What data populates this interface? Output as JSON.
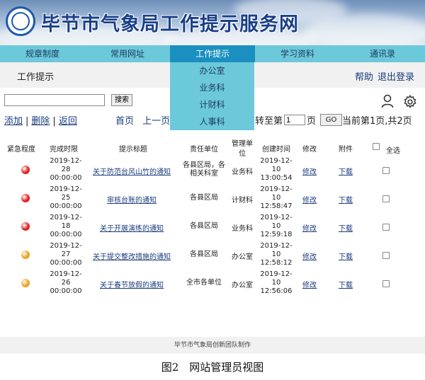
{
  "site_title": "毕节市气象局工作提示服务网",
  "nav": [
    "规章制度",
    "常用网址",
    "工作提示",
    "学习资料",
    "通讯录"
  ],
  "dropdown": [
    "办公室",
    "业务科",
    "计财科",
    "人事科"
  ],
  "page_title": "工作提示",
  "help": "帮助",
  "logout": "退出登录",
  "search": {
    "value": "",
    "button": "搜索"
  },
  "actions": {
    "add": "添加",
    "delete": "删除",
    "back": "返回",
    "sep": "|"
  },
  "pager": {
    "first": "首页",
    "prev": "上一页",
    "jump_prefix": "转至第",
    "page_value": "1",
    "page_suffix": "页",
    "go": "GO",
    "info": "当前第1页,共2页"
  },
  "table": {
    "headers": {
      "urgency": "紧急程度",
      "deadline": "完成时限",
      "title": "提示标题",
      "unit_line1": "责任单位",
      "mgmt_line1": "管理单",
      "mgmt_line2": "位",
      "created": "创建时间",
      "edit": "修改",
      "attach": "附件",
      "select_all": "全选"
    },
    "rows": [
      {
        "urgency": "#e02020",
        "deadline": [
          "2019-12-",
          "28",
          "00:00:00"
        ],
        "title": "关于防范台风山竹的通知",
        "unit": [
          "各县区局，各",
          "相关科室"
        ],
        "mgmt": "业务科",
        "created": [
          "2019-12-",
          "10",
          "13:00:54"
        ],
        "edit": "修改",
        "attach": "下载"
      },
      {
        "urgency": "#e02020",
        "deadline": [
          "2019-12-",
          "25",
          "00:00:00"
        ],
        "title": "审核台账的通知",
        "unit": [
          "各县区局"
        ],
        "mgmt": "计财科",
        "created": [
          "2019-12-",
          "10",
          "12:58:47"
        ],
        "edit": "修改",
        "attach": "下载"
      },
      {
        "urgency": "#e02020",
        "deadline": [
          "2019-12-",
          "18",
          "00:00:00"
        ],
        "title": "关于开展演练的通知",
        "unit": [
          "各县区局"
        ],
        "mgmt": "业务科",
        "created": [
          "2019-12-",
          "10",
          "12:59:18"
        ],
        "edit": "修改",
        "attach": "下载"
      },
      {
        "urgency": "#f0a020",
        "deadline": [
          "2019-12-",
          "27",
          "00:00:00"
        ],
        "title": "关于提交整改措施的通知",
        "unit": [
          "各县区局"
        ],
        "mgmt": "办公室",
        "created": [
          "2019-12-",
          "10",
          "12:58:12"
        ],
        "edit": "修改",
        "attach": "下载"
      },
      {
        "urgency": "#f0a020",
        "deadline": [
          "2019-12-",
          "26",
          "00:00:00"
        ],
        "title": "关于春节放假的通知",
        "unit": [
          "全市各单位"
        ],
        "mgmt": "办公室",
        "created": [
          "2019-12-",
          "10",
          "12:56:06"
        ],
        "edit": "修改",
        "attach": "下载"
      }
    ]
  },
  "footer": "毕节市气象局创新团队制作",
  "caption": "图2　网站管理员视图",
  "colors": {
    "nav_bg": "#6cc9d9",
    "nav_active": "#1a8fc0",
    "link": "#1a3c7c",
    "urgent_red": "#e02020",
    "urgent_orange": "#f0a020"
  },
  "icons": [
    "user-icon",
    "gear-icon",
    "logo-icon"
  ]
}
